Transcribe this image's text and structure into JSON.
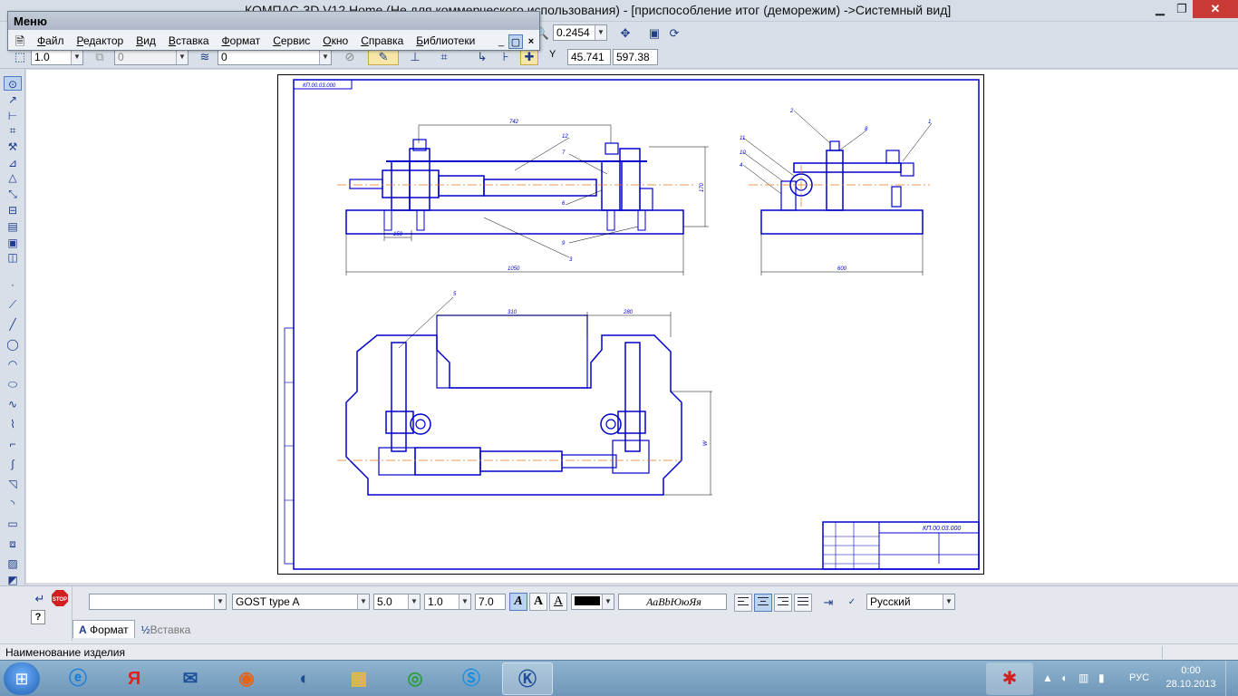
{
  "window": {
    "title": "КОМПАС-3D V12 Home (Не для коммерческого использования) - [приспособление итог (деморежим) ->Системный вид]",
    "minimize": "0",
    "maximize": "1",
    "close": "r"
  },
  "toolbar1": {
    "scale_value": "0.2454",
    "pan_icon": "pan-icon",
    "refresh_icon": "refresh-icon"
  },
  "toolbar2": {
    "line_width": "1.0",
    "layer": "0",
    "style": "0",
    "cursor_label": "Y",
    "cursor_x": "45.741",
    "cursor_y": "597.38"
  },
  "menu_window": {
    "caption": "Меню",
    "items": [
      "Файл",
      "Редактор",
      "Вид",
      "Вставка",
      "Формат",
      "Сервис",
      "Окно",
      "Справка",
      "Библиотеки"
    ],
    "minimize": "_",
    "restore": "▢",
    "close": "×"
  },
  "drawing": {
    "stamp_text": "КП.00.03.000",
    "title_block_code": "КП.00.03.000",
    "dim_742": "742",
    "dim_150": "150",
    "dim_1050": "1050",
    "dim_600": "600",
    "dim_170": "170",
    "dim_310": "310",
    "dim_280": "280",
    "dim_w": "W",
    "callouts": [
      "12",
      "7",
      "6",
      "3",
      "9",
      "2",
      "8",
      "1",
      "11",
      "10",
      "4",
      "5"
    ],
    "accent_color": "#0000d0",
    "axis_color": "#e0781e"
  },
  "propbar": {
    "style_select": "",
    "font": "GOST type A",
    "height": "5.0",
    "narrowing": "1.0",
    "step": "7.0",
    "italic": "A",
    "bold": "A",
    "underline": "A",
    "sample": "АаBbЮюЯя",
    "language": "Русский",
    "color": "#000000"
  },
  "tabs": [
    "Формат",
    "Вставка"
  ],
  "status": {
    "text": "Наименование изделия"
  },
  "taskbar": {
    "start": "⊞",
    "apps": [
      "internet-explorer-icon",
      "yandex-icon",
      "mail-icon",
      "firefox-icon",
      "media-icon",
      "folder-icon",
      "chrome-icon",
      "skype-icon",
      "kompas-icon"
    ],
    "yandex_label": "Я",
    "lang": "РУС",
    "time": "0:00",
    "date": "28.10.2013"
  }
}
